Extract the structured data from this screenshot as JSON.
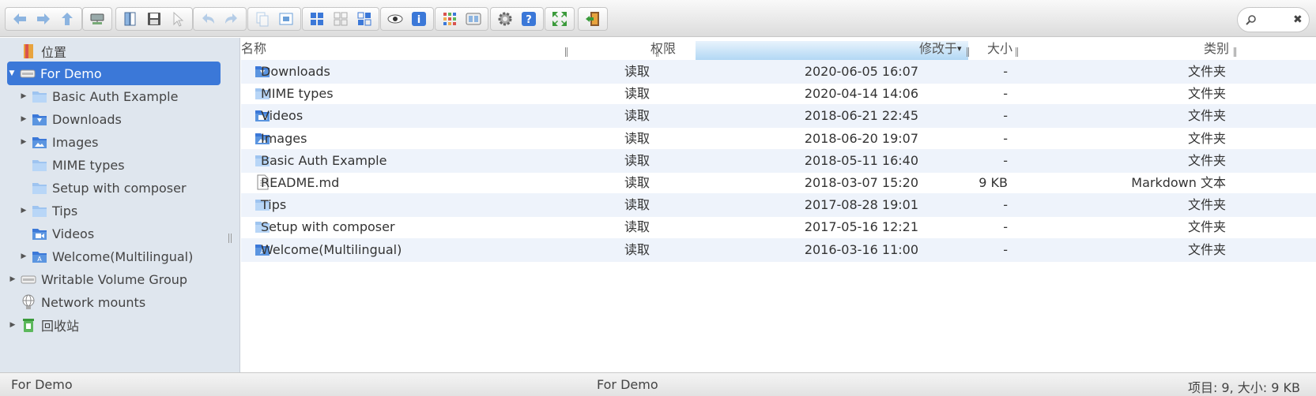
{
  "toolbar": {
    "groups": [
      {
        "name": "navigation",
        "buttons": [
          "back-icon",
          "forward-icon",
          "up-icon"
        ]
      },
      {
        "name": "mount",
        "buttons": [
          "server-icon"
        ]
      },
      {
        "name": "file",
        "buttons": [
          "open-icon",
          "save-icon",
          "select-icon"
        ]
      },
      {
        "name": "history",
        "buttons": [
          "undo-icon",
          "redo-icon"
        ]
      },
      {
        "name": "clipboard",
        "buttons": [
          "copy-icon",
          "paste-icon"
        ]
      },
      {
        "name": "select",
        "buttons": [
          "select-all-icon",
          "select-none-icon",
          "invert-select-icon"
        ]
      },
      {
        "name": "preview",
        "buttons": [
          "view-icon",
          "info-icon"
        ]
      },
      {
        "name": "view",
        "buttons": [
          "grid-view-icon",
          "list-view-icon"
        ]
      },
      {
        "name": "help",
        "buttons": [
          "settings-icon",
          "help-icon"
        ]
      },
      {
        "name": "screen",
        "buttons": [
          "fullscreen-icon"
        ]
      },
      {
        "name": "exit",
        "buttons": [
          "exit-icon"
        ]
      }
    ],
    "search_placeholder": "",
    "accent": "#3b78d8"
  },
  "sidebar": {
    "items": [
      {
        "label": "位置",
        "icon": "places-icon"
      },
      {
        "label": "For Demo",
        "icon": "volume-icon"
      },
      {
        "label": "Basic Auth Example",
        "icon": "folder-icon"
      },
      {
        "label": "Downloads",
        "icon": "downloads-folder-icon"
      },
      {
        "label": "Images",
        "icon": "images-folder-icon"
      },
      {
        "label": "MIME types",
        "icon": "folder-icon"
      },
      {
        "label": "Setup with composer",
        "icon": "folder-icon"
      },
      {
        "label": "Tips",
        "icon": "folder-icon"
      },
      {
        "label": "Videos",
        "icon": "videos-folder-icon"
      },
      {
        "label": "Welcome(Multilingual)",
        "icon": "text-folder-icon"
      },
      {
        "label": "Writable Volume Group",
        "icon": "volume-icon"
      },
      {
        "label": "Network mounts",
        "icon": "network-icon"
      },
      {
        "label": "回收站",
        "icon": "trash-icon"
      }
    ]
  },
  "table": {
    "columns": {
      "name": "名称",
      "perm": "权限",
      "modified": "修改于",
      "size": "大小",
      "kind": "类别"
    },
    "sort_indicator": "▾",
    "rows": [
      {
        "name": "Downloads",
        "perm": "读取",
        "modified": "2020-06-05 16:07",
        "size": "-",
        "kind": "文件夹",
        "icon": "downloads-folder-icon"
      },
      {
        "name": "MIME types",
        "perm": "读取",
        "modified": "2020-04-14 14:06",
        "size": "-",
        "kind": "文件夹",
        "icon": "folder-icon"
      },
      {
        "name": "Videos",
        "perm": "读取",
        "modified": "2018-06-21 22:45",
        "size": "-",
        "kind": "文件夹",
        "icon": "videos-folder-icon"
      },
      {
        "name": "Images",
        "perm": "读取",
        "modified": "2018-06-20 19:07",
        "size": "-",
        "kind": "文件夹",
        "icon": "images-folder-icon"
      },
      {
        "name": "Basic Auth Example",
        "perm": "读取",
        "modified": "2018-05-11 16:40",
        "size": "-",
        "kind": "文件夹",
        "icon": "folder-icon"
      },
      {
        "name": "README.md",
        "perm": "读取",
        "modified": "2018-03-07 15:20",
        "size": "9 KB",
        "kind": "Markdown 文本",
        "icon": "document-icon"
      },
      {
        "name": "Tips",
        "perm": "读取",
        "modified": "2017-08-28 19:01",
        "size": "-",
        "kind": "文件夹",
        "icon": "folder-icon"
      },
      {
        "name": "Setup with composer",
        "perm": "读取",
        "modified": "2017-05-16 12:21",
        "size": "-",
        "kind": "文件夹",
        "icon": "folder-icon"
      },
      {
        "name": "Welcome(Multilingual)",
        "perm": "读取",
        "modified": "2016-03-16 11:00",
        "size": "-",
        "kind": "文件夹",
        "icon": "text-folder-icon"
      }
    ]
  },
  "status": {
    "left": "For Demo",
    "center": "For Demo",
    "right": "项目: 9, 大小: 9 KB"
  }
}
